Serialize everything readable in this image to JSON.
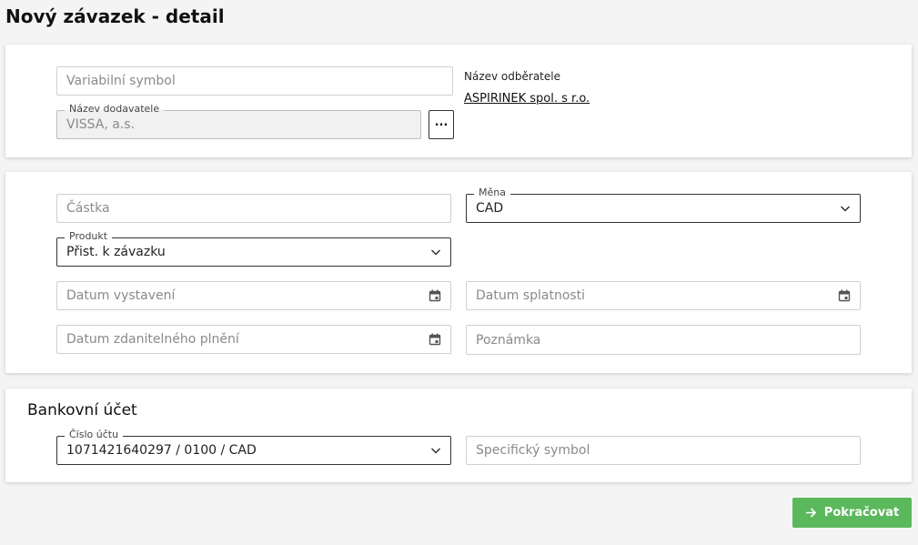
{
  "page": {
    "title": "Nový závazek - detail"
  },
  "supplier_section": {
    "variable_symbol": {
      "placeholder": "Variabilní symbol",
      "value": ""
    },
    "supplier_name": {
      "label": "Název dodavatele",
      "value": "VISSA, a.s."
    },
    "browse_label": "...",
    "customer_label": "Název odběratele",
    "customer_name": "ASPIRINEK spol. s r.o."
  },
  "amount_section": {
    "amount": {
      "placeholder": "Částka",
      "value": ""
    },
    "currency": {
      "label": "Měna",
      "value": "CAD"
    },
    "product": {
      "label": "Produkt",
      "value": "Přist. k závazku"
    },
    "issue_date": {
      "placeholder": "Datum vystavení"
    },
    "due_date": {
      "placeholder": "Datum splatnosti"
    },
    "taxable_date": {
      "placeholder": "Datum zdanitelného plnění"
    },
    "note": {
      "placeholder": "Poznámka"
    }
  },
  "bank_section": {
    "title": "Bankovní účet",
    "account": {
      "label": "Číslo účtu",
      "value": "1071421640297 / 0100 / CAD"
    },
    "specific_symbol": {
      "placeholder": "Specifický symbol"
    }
  },
  "actions": {
    "continue_label": "Pokračovat"
  },
  "colors": {
    "accent_button": "#5cb85c",
    "border": "#cfcfcf",
    "text": "#222222"
  },
  "icons": {
    "dropdown": "chevron-down-icon",
    "date": "calendar-icon",
    "continue": "arrow-right-icon"
  }
}
